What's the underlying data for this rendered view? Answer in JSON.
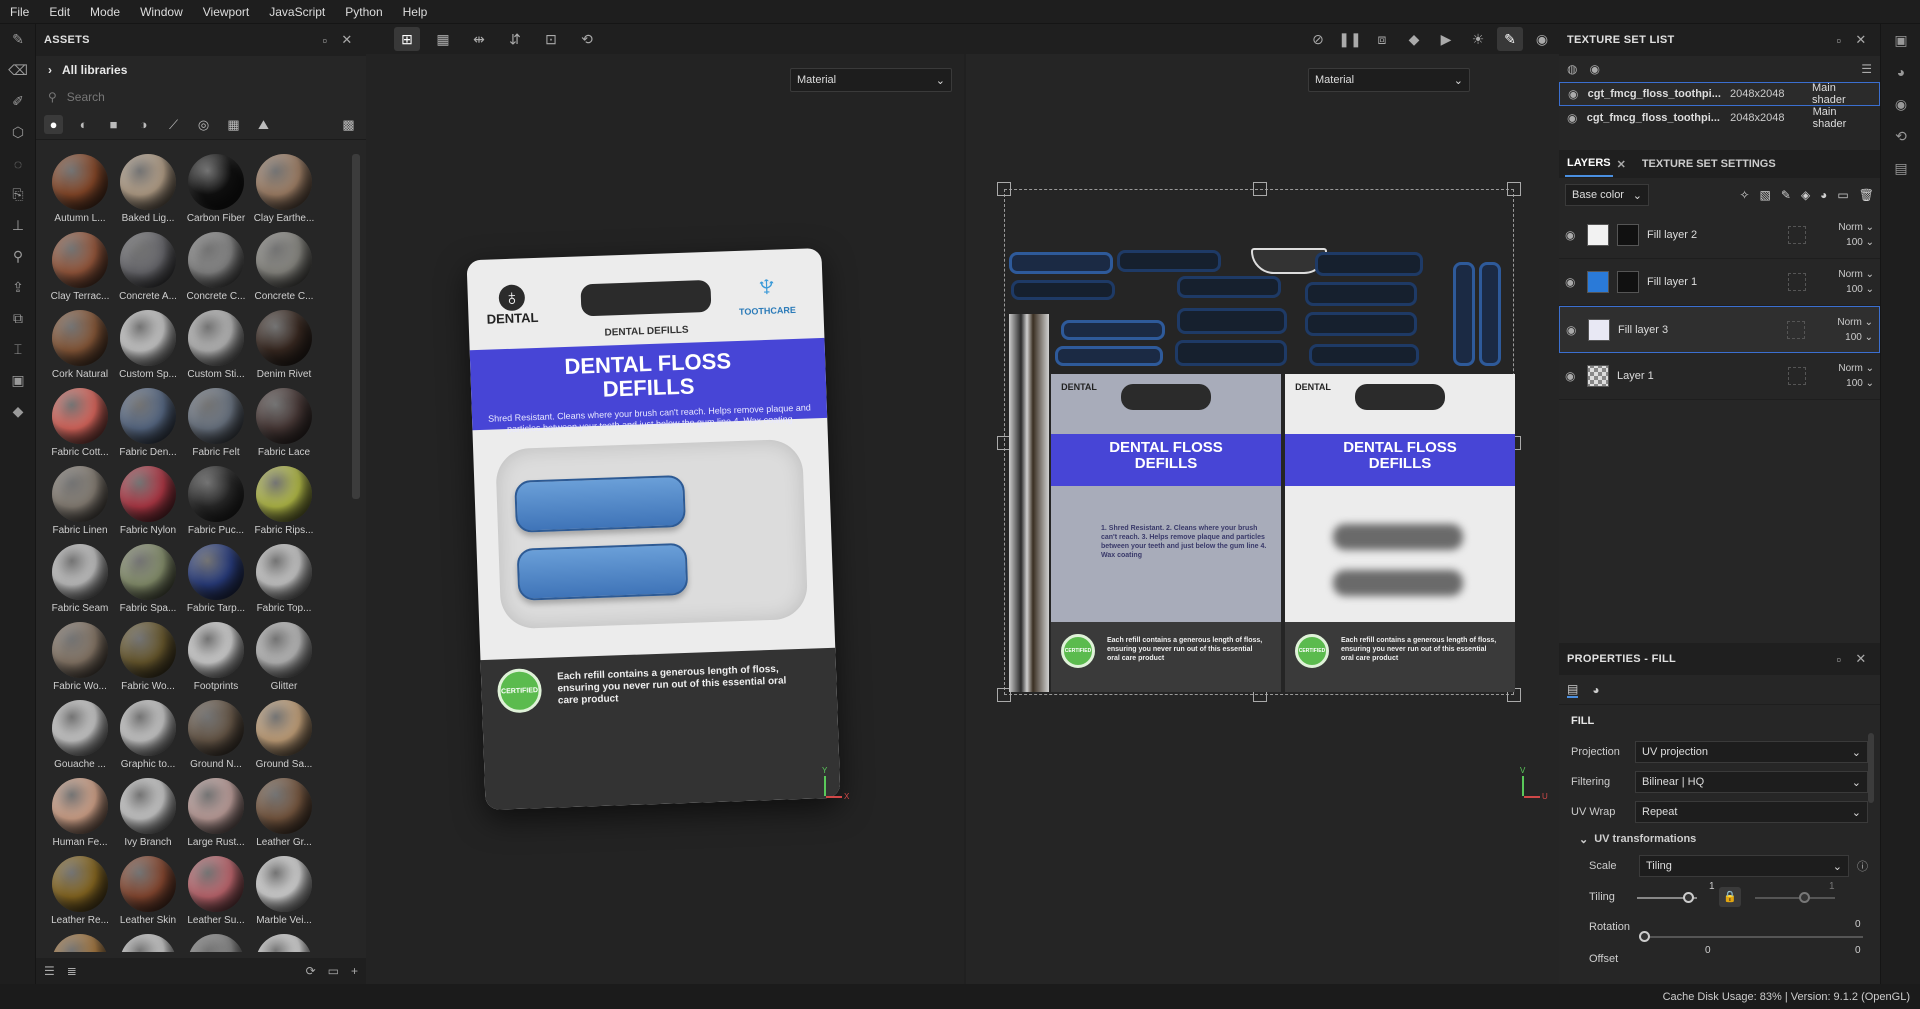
{
  "menu": [
    "File",
    "Edit",
    "Mode",
    "Window",
    "Viewport",
    "JavaScript",
    "Python",
    "Help"
  ],
  "assets": {
    "title": "ASSETS",
    "libraries": "All libraries",
    "search_placeholder": "Search",
    "materials": [
      {
        "name": "Autumn L...",
        "color": "#8a4a2a"
      },
      {
        "name": "Baked Lig...",
        "color": "#b9a48c"
      },
      {
        "name": "Carbon Fiber",
        "color": "#111111"
      },
      {
        "name": "Clay Earthe...",
        "color": "#a5846a"
      },
      {
        "name": "Clay Terrac...",
        "color": "#9a5a3e"
      },
      {
        "name": "Concrete A...",
        "color": "#6b6b70"
      },
      {
        "name": "Concrete C...",
        "color": "#8a8a8a"
      },
      {
        "name": "Concrete C...",
        "color": "#8d8c86"
      },
      {
        "name": "Cork Natural",
        "color": "#8a5a3a"
      },
      {
        "name": "Custom Sp...",
        "color": "#cfcfcf"
      },
      {
        "name": "Custom Sti...",
        "color": "#bdbdbd"
      },
      {
        "name": "Denim Rivet",
        "color": "#3a2a22"
      },
      {
        "name": "Fabric Cott...",
        "color": "#e06a60"
      },
      {
        "name": "Fabric Den...",
        "color": "#5a6c88"
      },
      {
        "name": "Fabric Felt",
        "color": "#6e7886"
      },
      {
        "name": "Fabric Lace",
        "color": "#4a3a38"
      },
      {
        "name": "Fabric Linen",
        "color": "#8a8278"
      },
      {
        "name": "Fabric Nylon",
        "color": "#b43a48"
      },
      {
        "name": "Fabric Puc...",
        "color": "#2a2a2a"
      },
      {
        "name": "Fabric Rips...",
        "color": "#b8c04a"
      },
      {
        "name": "Fabric Seam",
        "color": "#c8c8c8"
      },
      {
        "name": "Fabric Spa...",
        "color": "#8a9470"
      },
      {
        "name": "Fabric Tarp...",
        "color": "#2a3e80"
      },
      {
        "name": "Fabric Top...",
        "color": "#cfcfcf"
      },
      {
        "name": "Fabric Wo...",
        "color": "#8a7a6a"
      },
      {
        "name": "Fabric Wo...",
        "color": "#6a5a2e"
      },
      {
        "name": "Footprints",
        "color": "#d8d8d8"
      },
      {
        "name": "Glitter",
        "color": "#c0c0c0"
      },
      {
        "name": "Gouache ...",
        "color": "#d0d0d0"
      },
      {
        "name": "Graphic to...",
        "color": "#cfcfcf"
      },
      {
        "name": "Ground N...",
        "color": "#6a5a4a"
      },
      {
        "name": "Ground Sa...",
        "color": "#c9a67e"
      },
      {
        "name": "Human Fe...",
        "color": "#d8a88e"
      },
      {
        "name": "Ivy Branch",
        "color": "#d0d0d0"
      },
      {
        "name": "Large Rust...",
        "color": "#c4a4a0"
      },
      {
        "name": "Leather Gr...",
        "color": "#7a5a42"
      },
      {
        "name": "Leather Re...",
        "color": "#8a6a22"
      },
      {
        "name": "Leather Skin",
        "color": "#8a4a32"
      },
      {
        "name": "Leather Su...",
        "color": "#c46a72"
      },
      {
        "name": "Marble Vei...",
        "color": "#dcdcdc"
      },
      {
        "name": "",
        "color": "#a87a42"
      },
      {
        "name": "",
        "color": "#cfcfcf"
      },
      {
        "name": "",
        "color": "#8a8a8a"
      },
      {
        "name": "",
        "color": "#dadada"
      }
    ]
  },
  "viewport": {
    "left_mode": "Material",
    "right_mode": "Material",
    "package": {
      "brand_left": "DENTAL",
      "brand_right": "TOOTHCARE",
      "subtitle": "DENTAL DEFILLS",
      "title_line1": "DENTAL FLOSS",
      "title_line2": "DEFILLS",
      "description": "Shred Resistant. Cleans where your brush can't reach. Helps remove plaque and particles between your teeth and just below the gum line 4. Wax coating",
      "certified": "CERTIFIED",
      "bottom_text": "Each refill contains a generous length of floss, ensuring you never run out of this essential oral care product"
    },
    "uv_back_list": "1. Shred Resistant. 2. Cleans where your brush can't reach. 3. Helps remove plaque and particles between your teeth and just below the gum line 4. Wax coating",
    "axis_y": "Y",
    "axis_x": "X",
    "axis_v": "V",
    "axis_u": "U"
  },
  "texture_sets": {
    "title": "TEXTURE SET LIST",
    "items": [
      {
        "name": "cgt_fmcg_floss_toothpi...",
        "res": "2048x2048",
        "shader": "Main shader"
      },
      {
        "name": "cgt_fmcg_floss_toothpi...",
        "res": "2048x2048",
        "shader": "Main shader"
      }
    ]
  },
  "layers": {
    "tab_layers": "LAYERS",
    "tab_settings": "TEXTURE SET SETTINGS",
    "channel": "Base color",
    "items": [
      {
        "name": "Fill layer 2",
        "blend": "Norm",
        "opacity": "100"
      },
      {
        "name": "Fill layer 1",
        "blend": "Norm",
        "opacity": "100"
      },
      {
        "name": "Fill layer 3",
        "blend": "Norm",
        "opacity": "100"
      },
      {
        "name": "Layer 1",
        "blend": "Norm",
        "opacity": "100"
      }
    ]
  },
  "properties": {
    "title": "PROPERTIES - FILL",
    "section": "FILL",
    "projection_label": "Projection",
    "projection": "UV projection",
    "filtering_label": "Filtering",
    "filtering": "Bilinear | HQ",
    "uvwrap_label": "UV Wrap",
    "uvwrap": "Repeat",
    "uv_transform": "UV transformations",
    "scale_label": "Scale",
    "scale": "Tiling",
    "tiling_label": "Tiling",
    "tiling_val_a": "1",
    "tiling_val_b": "1",
    "rotation_label": "Rotation",
    "rotation": "0",
    "offset_label": "Offset",
    "offset_a": "0",
    "offset_b": "0"
  },
  "status": "Cache Disk Usage:   83% | Version: 9.1.2 (OpenGL)"
}
